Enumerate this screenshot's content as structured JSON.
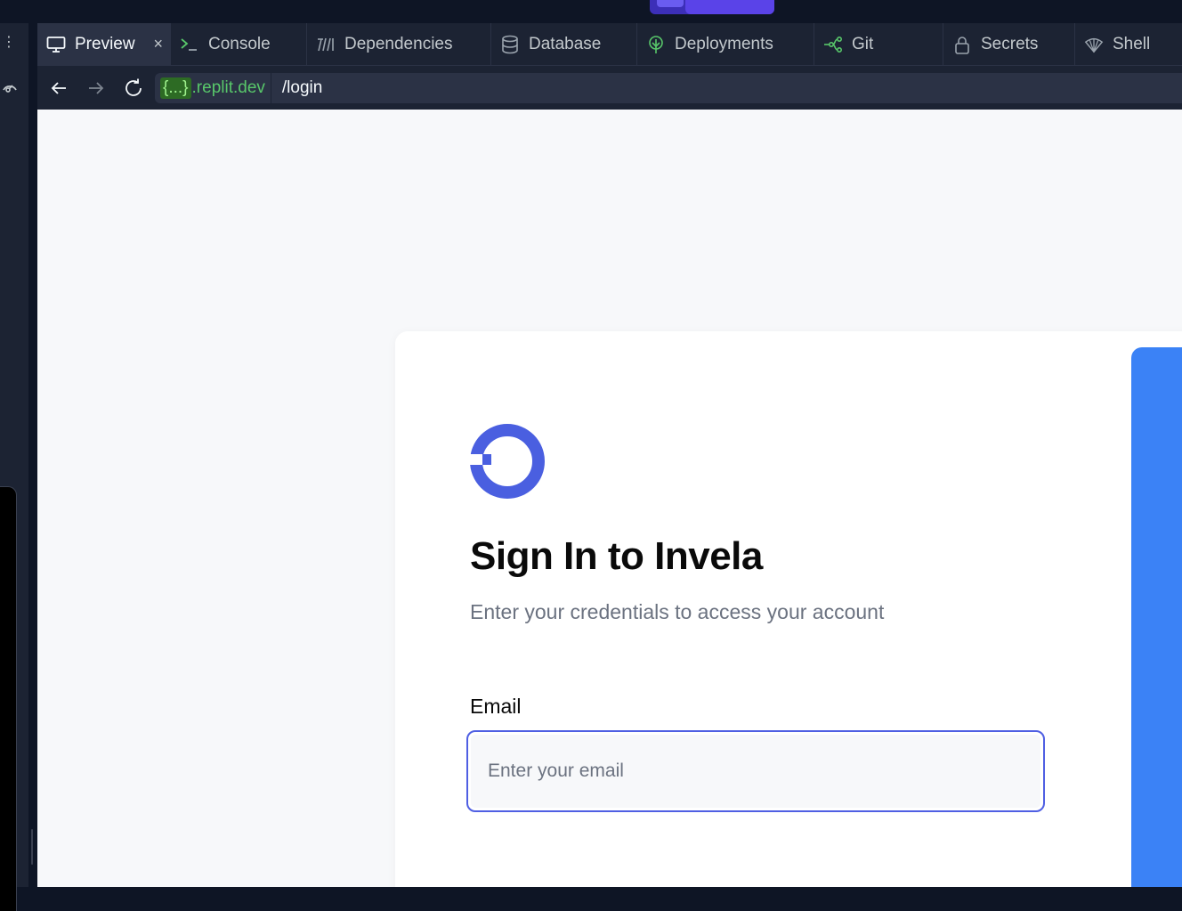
{
  "tabs": [
    {
      "label": "Preview",
      "icon": "monitor-icon",
      "active": true
    },
    {
      "label": "Console",
      "icon": "terminal-icon"
    },
    {
      "label": "Dependencies",
      "icon": "dependencies-icon"
    },
    {
      "label": "Database",
      "icon": "database-icon"
    },
    {
      "label": "Deployments",
      "icon": "deployments-icon"
    },
    {
      "label": "Git",
      "icon": "git-icon"
    },
    {
      "label": "Secrets",
      "icon": "lock-icon"
    },
    {
      "label": "Shell",
      "icon": "shell-icon"
    }
  ],
  "tab_close_glyph": "×",
  "url": {
    "host_badge": "{...}",
    "host_suffix": ".replit.dev",
    "path": "/login"
  },
  "login": {
    "title": "Sign In to Invela",
    "subtitle": "Enter your credentials to access your account",
    "email_label": "Email",
    "email_placeholder": "Enter your email",
    "email_value": ""
  },
  "colors": {
    "brand": "#4a5fe0",
    "accent_panel": "#3b82f6",
    "ide_bg": "#1c2333",
    "url_green": "#58c76a"
  }
}
